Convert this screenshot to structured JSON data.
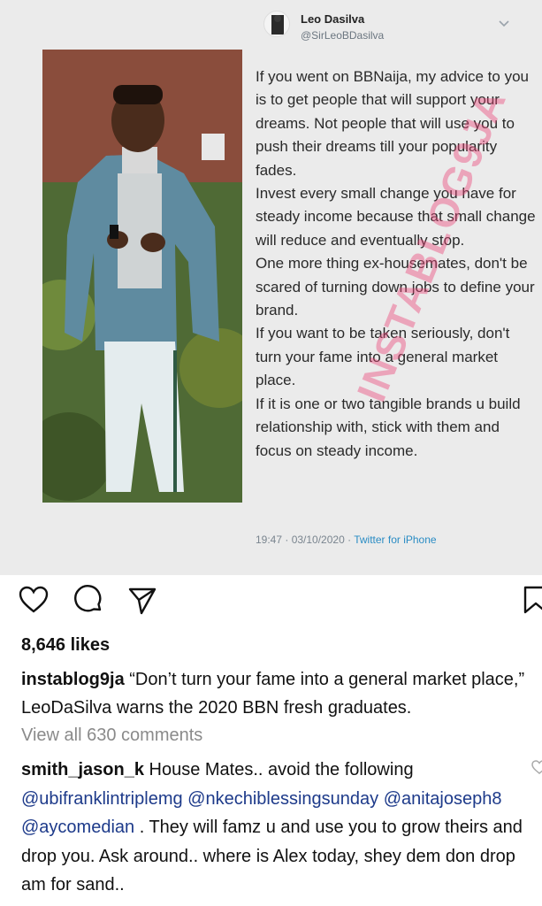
{
  "tweet": {
    "author_name": "Leo Dasilva",
    "author_handle": "@SirLeoBDasilva",
    "paragraphs": [
      "If you went on BBNaija, my advice to you is to get people that will support your dreams. Not people that will use you to push their dreams till your popularity fades.",
      "Invest every small change you have for steady income because that small change will reduce and eventually stop.",
      "One more thing ex-housemates, don't be scared of turning down jobs to define your brand.",
      "If you want to be taken seriously, don't turn your fame into a general market place.",
      "If it is one or two tangible brands u build relationship with, stick with them and focus on steady income."
    ],
    "timestamp": "19:47 · 03/10/2020 · ",
    "source": "Twitter for iPhone",
    "watermark": "INSTABLOG9JA"
  },
  "post": {
    "likes": "8,646 likes",
    "caption_user": "instablog9ja",
    "caption_text": " “Don’t turn your fame into a general market place,” LeoDaSilva warns the 2020 BBN fresh graduates.",
    "view_all_comments": "View all 630 comments",
    "comment": {
      "user": "smith_jason_k",
      "text_1": " House Mates.. avoid the following ",
      "mention_1": "@ubifranklintriplemg",
      "sep_1": " ",
      "mention_2": "@nkechiblessingsunday",
      "sep_2": " ",
      "mention_3": "@anitajoseph8",
      "sep_3": " ",
      "mention_4": "@aycomedian",
      "text_2": " . They will famz u and use you to grow theirs and drop you. Ask around.. where is Alex today, shey dem don drop am for sand.."
    }
  },
  "icons": {
    "like": "heart-icon",
    "comment": "comment-bubble-icon",
    "share": "paper-plane-icon",
    "save": "bookmark-icon",
    "tweet_menu": "chevron-down-icon"
  },
  "colors": {
    "mention": "#1d3a8a",
    "tweet_source": "#2a8cc4",
    "watermark": "#ec4278",
    "muted": "#8a8a8a"
  }
}
